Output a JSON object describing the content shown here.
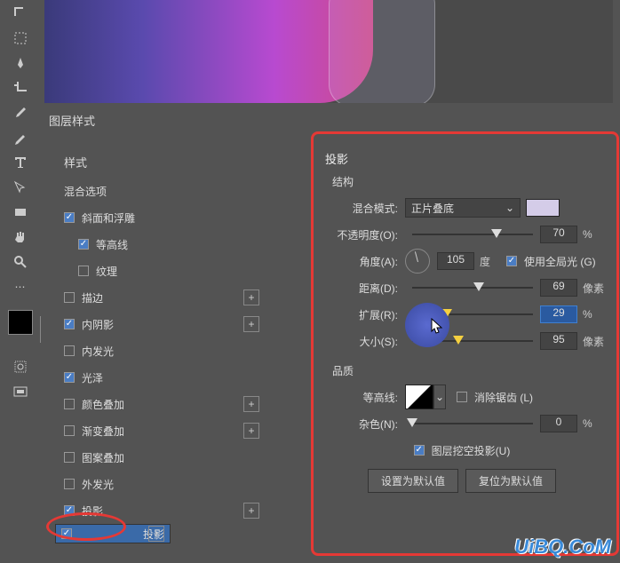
{
  "dialog_title": "图层样式",
  "styles": {
    "header": "样式",
    "blend_options": "混合选项",
    "bevel": "斜面和浮雕",
    "contour": "等高线",
    "texture": "纹理",
    "stroke": "描边",
    "inner_shadow": "内阴影",
    "inner_glow": "内发光",
    "satin": "光泽",
    "color_overlay": "颜色叠加",
    "gradient_overlay": "渐变叠加",
    "pattern_overlay": "图案叠加",
    "outer_glow": "外发光",
    "drop_shadow1": "投影",
    "drop_shadow2": "投影"
  },
  "detail": {
    "title": "投影",
    "structure": "结构",
    "blend_mode_lbl": "混合模式:",
    "blend_mode_val": "正片叠底",
    "opacity_lbl": "不透明度(O):",
    "opacity_val": "70",
    "percent": "%",
    "angle_lbl": "角度(A):",
    "angle_val": "105",
    "degree": "度",
    "use_global": "使用全局光 (G)",
    "distance_lbl": "距离(D):",
    "distance_val": "69",
    "px": "像素",
    "spread_lbl": "扩展(R):",
    "spread_val": "29",
    "size_lbl": "大小(S):",
    "size_val": "95",
    "quality": "品质",
    "contour_lbl": "等高线:",
    "antialias": "消除锯齿 (L)",
    "noise_lbl": "杂色(N):",
    "noise_val": "0",
    "knockout": "图层挖空投影(U)",
    "make_default": "设置为默认值",
    "reset_default": "复位为默认值"
  },
  "watermark": "UiBQ.CoM"
}
